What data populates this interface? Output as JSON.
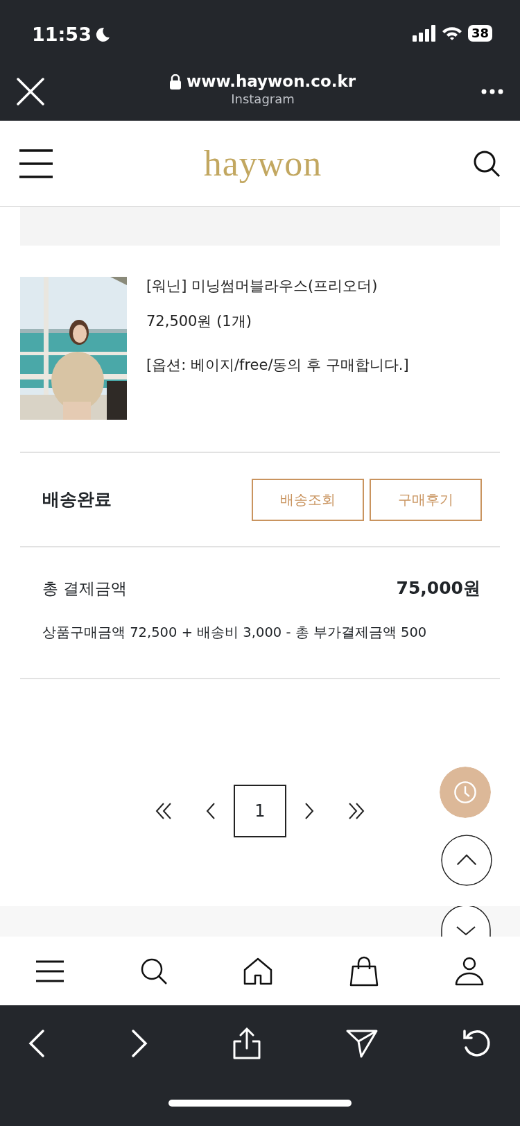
{
  "status_bar": {
    "time": "11:53",
    "battery": "38"
  },
  "browser": {
    "url": "www.haywon.co.kr",
    "subtitle": "Instagram"
  },
  "header": {
    "logo": "haywon"
  },
  "order_item": {
    "name": "[워닌] 미닝썸머블라우스(프리오더)",
    "price": "72,500원 (1개)",
    "option": "[옵션: 베이지/free/동의 후 구매합니다.]"
  },
  "delivery": {
    "status": "배송완료",
    "buttons": [
      "배송조회",
      "구매후기"
    ]
  },
  "payment": {
    "label": "총 결제금액",
    "total": "75,000원",
    "breakdown": "상품구매금액 72,500 + 배송비 3,000 - 총 부가결제금액 500"
  },
  "pagination": {
    "pages": [
      {
        "label": "1",
        "selected": true
      }
    ]
  }
}
